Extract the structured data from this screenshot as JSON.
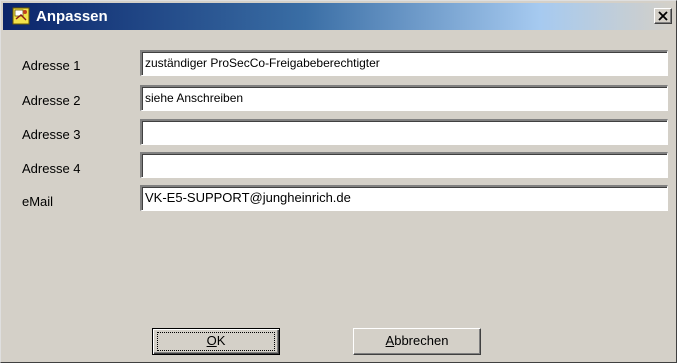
{
  "window": {
    "title": "Anpassen"
  },
  "icons": {
    "app": "app-icon",
    "close": "close-icon"
  },
  "form": {
    "fields": [
      {
        "label": "Adresse 1",
        "value": "zuständiger ProSecCo-Freigabeberechtigter"
      },
      {
        "label": "Adresse 2",
        "value": "siehe Anschreiben"
      },
      {
        "label": "Adresse 3",
        "value": ""
      },
      {
        "label": "Adresse 4",
        "value": ""
      },
      {
        "label": "eMail",
        "value": "VK-E5-SUPPORT@jungheinrich.de"
      }
    ]
  },
  "buttons": {
    "ok_mnemonic": "O",
    "ok_rest": "K",
    "cancel_mnemonic": "A",
    "cancel_rest": "bbrechen"
  },
  "colors": {
    "titlebar_start": "#0a246a",
    "titlebar_end": "#d4d0c8",
    "dialog_face": "#d4d0c8"
  }
}
